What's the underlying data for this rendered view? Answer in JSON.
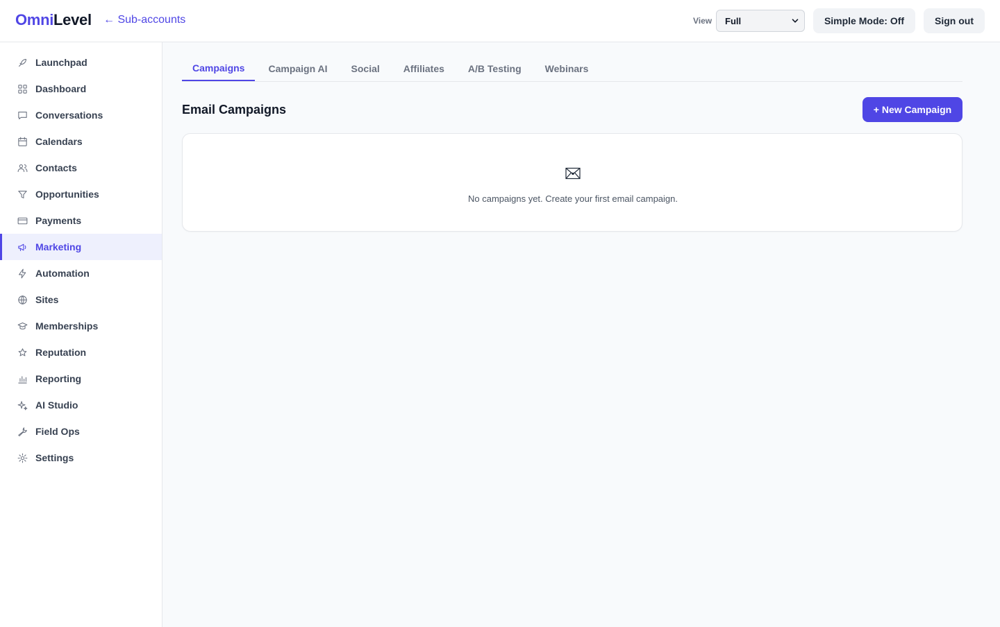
{
  "header": {
    "logo_part1": "Omni",
    "logo_part2": "Level",
    "back_link": "← Sub-accounts",
    "view_label": "View",
    "view_value": "Full",
    "simple_mode": "Simple Mode: Off",
    "sign_out": "Sign out"
  },
  "sidebar": {
    "items": [
      {
        "label": "Launchpad",
        "icon": "rocket-icon"
      },
      {
        "label": "Dashboard",
        "icon": "grid-icon"
      },
      {
        "label": "Conversations",
        "icon": "chat-icon"
      },
      {
        "label": "Calendars",
        "icon": "calendar-icon"
      },
      {
        "label": "Contacts",
        "icon": "users-icon"
      },
      {
        "label": "Opportunities",
        "icon": "funnel-icon"
      },
      {
        "label": "Payments",
        "icon": "credit-card-icon"
      },
      {
        "label": "Marketing",
        "icon": "megaphone-icon",
        "active": true
      },
      {
        "label": "Automation",
        "icon": "lightning-icon"
      },
      {
        "label": "Sites",
        "icon": "globe-icon"
      },
      {
        "label": "Memberships",
        "icon": "graduation-cap-icon"
      },
      {
        "label": "Reputation",
        "icon": "star-icon"
      },
      {
        "label": "Reporting",
        "icon": "bar-chart-icon"
      },
      {
        "label": "AI Studio",
        "icon": "sparkle-icon"
      },
      {
        "label": "Field Ops",
        "icon": "wrench-icon"
      },
      {
        "label": "Settings",
        "icon": "gear-icon"
      }
    ]
  },
  "main": {
    "tabs": [
      {
        "label": "Campaigns",
        "active": true
      },
      {
        "label": "Campaign AI"
      },
      {
        "label": "Social"
      },
      {
        "label": "Affiliates"
      },
      {
        "label": "A/B Testing"
      },
      {
        "label": "Webinars"
      }
    ],
    "section_title": "Email Campaigns",
    "new_button": "+ New Campaign",
    "empty_icon": "envelope-icon",
    "empty_text": "No campaigns yet. Create your first email campaign."
  },
  "colors": {
    "accent": "#4f46e5",
    "active_bg": "#eef0fd"
  }
}
